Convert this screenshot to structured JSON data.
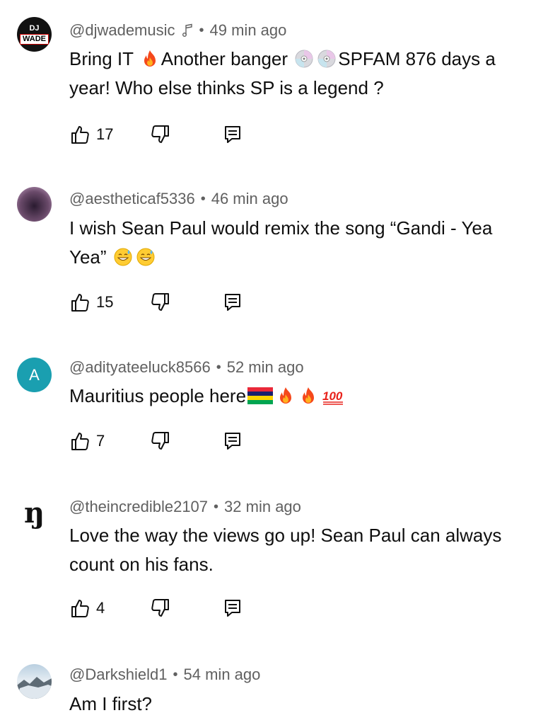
{
  "comments": [
    {
      "author": "@djwademusic",
      "time": "49 min ago",
      "has_note_icon": true,
      "avatar_text": "DJ",
      "avatar_text2": "WADE",
      "text_parts": [
        "Bring IT ",
        "Another banger ",
        "SPFAM 876 days a year! Who else thinks SP is a legend ?"
      ],
      "likes": "17"
    },
    {
      "author": "@aestheticaf5336",
      "time": "46 min ago",
      "text_parts": [
        "I wish Sean Paul would remix the song “Gandi - Yea Yea” "
      ],
      "likes": "15"
    },
    {
      "author": "@adityateeluck8566",
      "time": "52 min ago",
      "avatar_letter": "A",
      "text_parts": [
        "Mauritius people here"
      ],
      "likes": "7"
    },
    {
      "author": "@theincredible2107",
      "time": "32 min ago",
      "avatar_letter": "ŋ",
      "text_parts": [
        "Love the way the views go up! Sean Paul can always count on his fans."
      ],
      "likes": "4"
    },
    {
      "author": "@Darkshield1",
      "time": "54 min ago",
      "text_parts": [
        "Am I first?"
      ]
    }
  ],
  "colors": {
    "meta": "#606060",
    "text": "#0f0f0f",
    "avatar_a": "#1a9fb0"
  },
  "icons": [
    "music-note-icon",
    "like-icon",
    "dislike-icon",
    "reply-icon",
    "fire-emoji",
    "cd-emoji",
    "sweat-smile-emoji",
    "mauritius-flag-emoji",
    "hundred-emoji"
  ]
}
